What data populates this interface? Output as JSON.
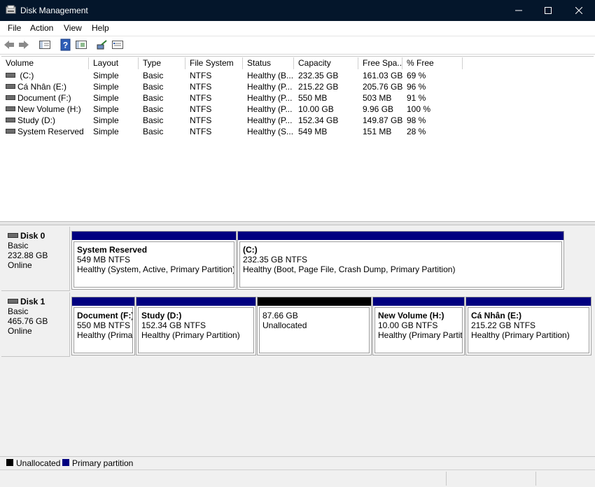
{
  "window": {
    "title": "Disk Management"
  },
  "menu": [
    "File",
    "Action",
    "View",
    "Help"
  ],
  "icons": {
    "app": "disk-management-icon",
    "back": "arrow-left-icon",
    "forward": "arrow-right-icon",
    "console": "console-tree-icon",
    "help": "help-icon",
    "properties": "properties-icon",
    "connect": "connect-icon",
    "view": "view-icon"
  },
  "volume_list": {
    "columns": [
      "Volume",
      "Layout",
      "Type",
      "File System",
      "Status",
      "Capacity",
      "Free Spa...",
      "% Free"
    ],
    "rows": [
      [
        " (C:)",
        "Simple",
        "Basic",
        "NTFS",
        "Healthy (B...",
        "232.35 GB",
        "161.03 GB",
        "69 %"
      ],
      [
        "Cá Nhân (E:)",
        "Simple",
        "Basic",
        "NTFS",
        "Healthy (P...",
        "215.22 GB",
        "205.76 GB",
        "96 %"
      ],
      [
        "Document (F:)",
        "Simple",
        "Basic",
        "NTFS",
        "Healthy (P...",
        "550 MB",
        "503 MB",
        "91 %"
      ],
      [
        "New Volume (H:)",
        "Simple",
        "Basic",
        "NTFS",
        "Healthy (P...",
        "10.00 GB",
        "9.96 GB",
        "100 %"
      ],
      [
        "Study (D:)",
        "Simple",
        "Basic",
        "NTFS",
        "Healthy (P...",
        "152.34 GB",
        "149.87 GB",
        "98 %"
      ],
      [
        "System Reserved",
        "Simple",
        "Basic",
        "NTFS",
        "Healthy (S...",
        "549 MB",
        "151 MB",
        "28 %"
      ]
    ]
  },
  "disks": [
    {
      "name": "Disk 0",
      "type": "Basic",
      "size": "232.88 GB",
      "status": "Online",
      "partitions": [
        {
          "name": "System Reserved",
          "size": "549 MB NTFS",
          "status": "Healthy (System, Active, Primary Partition)",
          "kind": "primary"
        },
        {
          "name": " (C:)",
          "size": "232.35 GB NTFS",
          "status": "Healthy (Boot, Page File, Crash Dump, Primary Partition)",
          "kind": "primary"
        }
      ]
    },
    {
      "name": "Disk 1",
      "type": "Basic",
      "size": "465.76 GB",
      "status": "Online",
      "partitions": [
        {
          "name": "Document  (F:)",
          "size": "550 MB NTFS",
          "status": "Healthy (Prima",
          "kind": "primary"
        },
        {
          "name": "Study  (D:)",
          "size": "152.34 GB NTFS",
          "status": "Healthy (Primary Partition)",
          "kind": "primary"
        },
        {
          "name": "",
          "size": "87.66 GB",
          "status": "Unallocated",
          "kind": "unallocated"
        },
        {
          "name": "New Volume  (H:)",
          "size": "10.00 GB NTFS",
          "status": "Healthy (Primary Partiti",
          "kind": "primary"
        },
        {
          "name": "Cá Nhân  (E:)",
          "size": "215.22 GB NTFS",
          "status": "Healthy (Primary Partition)",
          "kind": "primary"
        }
      ]
    }
  ],
  "legend": [
    {
      "label": "Unallocated",
      "color": "#000000"
    },
    {
      "label": "Primary partition",
      "color": "#010080"
    }
  ],
  "colors": {
    "titlebar": "#04162b",
    "primary": "#010080",
    "unallocated": "#000000"
  }
}
